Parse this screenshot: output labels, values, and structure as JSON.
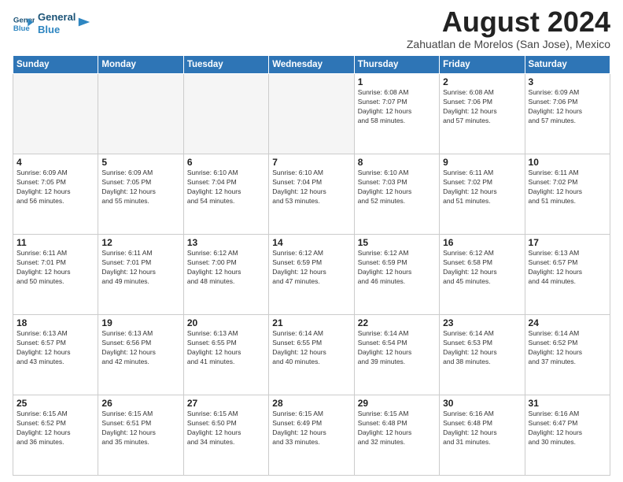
{
  "logo": {
    "line1": "General",
    "line2": "Blue"
  },
  "title": "August 2024",
  "location": "Zahuatlan de Morelos (San Jose), Mexico",
  "headers": [
    "Sunday",
    "Monday",
    "Tuesday",
    "Wednesday",
    "Thursday",
    "Friday",
    "Saturday"
  ],
  "weeks": [
    [
      {
        "day": "",
        "info": ""
      },
      {
        "day": "",
        "info": ""
      },
      {
        "day": "",
        "info": ""
      },
      {
        "day": "",
        "info": ""
      },
      {
        "day": "1",
        "info": "Sunrise: 6:08 AM\nSunset: 7:07 PM\nDaylight: 12 hours\nand 58 minutes."
      },
      {
        "day": "2",
        "info": "Sunrise: 6:08 AM\nSunset: 7:06 PM\nDaylight: 12 hours\nand 57 minutes."
      },
      {
        "day": "3",
        "info": "Sunrise: 6:09 AM\nSunset: 7:06 PM\nDaylight: 12 hours\nand 57 minutes."
      }
    ],
    [
      {
        "day": "4",
        "info": "Sunrise: 6:09 AM\nSunset: 7:05 PM\nDaylight: 12 hours\nand 56 minutes."
      },
      {
        "day": "5",
        "info": "Sunrise: 6:09 AM\nSunset: 7:05 PM\nDaylight: 12 hours\nand 55 minutes."
      },
      {
        "day": "6",
        "info": "Sunrise: 6:10 AM\nSunset: 7:04 PM\nDaylight: 12 hours\nand 54 minutes."
      },
      {
        "day": "7",
        "info": "Sunrise: 6:10 AM\nSunset: 7:04 PM\nDaylight: 12 hours\nand 53 minutes."
      },
      {
        "day": "8",
        "info": "Sunrise: 6:10 AM\nSunset: 7:03 PM\nDaylight: 12 hours\nand 52 minutes."
      },
      {
        "day": "9",
        "info": "Sunrise: 6:11 AM\nSunset: 7:02 PM\nDaylight: 12 hours\nand 51 minutes."
      },
      {
        "day": "10",
        "info": "Sunrise: 6:11 AM\nSunset: 7:02 PM\nDaylight: 12 hours\nand 51 minutes."
      }
    ],
    [
      {
        "day": "11",
        "info": "Sunrise: 6:11 AM\nSunset: 7:01 PM\nDaylight: 12 hours\nand 50 minutes."
      },
      {
        "day": "12",
        "info": "Sunrise: 6:11 AM\nSunset: 7:01 PM\nDaylight: 12 hours\nand 49 minutes."
      },
      {
        "day": "13",
        "info": "Sunrise: 6:12 AM\nSunset: 7:00 PM\nDaylight: 12 hours\nand 48 minutes."
      },
      {
        "day": "14",
        "info": "Sunrise: 6:12 AM\nSunset: 6:59 PM\nDaylight: 12 hours\nand 47 minutes."
      },
      {
        "day": "15",
        "info": "Sunrise: 6:12 AM\nSunset: 6:59 PM\nDaylight: 12 hours\nand 46 minutes."
      },
      {
        "day": "16",
        "info": "Sunrise: 6:12 AM\nSunset: 6:58 PM\nDaylight: 12 hours\nand 45 minutes."
      },
      {
        "day": "17",
        "info": "Sunrise: 6:13 AM\nSunset: 6:57 PM\nDaylight: 12 hours\nand 44 minutes."
      }
    ],
    [
      {
        "day": "18",
        "info": "Sunrise: 6:13 AM\nSunset: 6:57 PM\nDaylight: 12 hours\nand 43 minutes."
      },
      {
        "day": "19",
        "info": "Sunrise: 6:13 AM\nSunset: 6:56 PM\nDaylight: 12 hours\nand 42 minutes."
      },
      {
        "day": "20",
        "info": "Sunrise: 6:13 AM\nSunset: 6:55 PM\nDaylight: 12 hours\nand 41 minutes."
      },
      {
        "day": "21",
        "info": "Sunrise: 6:14 AM\nSunset: 6:55 PM\nDaylight: 12 hours\nand 40 minutes."
      },
      {
        "day": "22",
        "info": "Sunrise: 6:14 AM\nSunset: 6:54 PM\nDaylight: 12 hours\nand 39 minutes."
      },
      {
        "day": "23",
        "info": "Sunrise: 6:14 AM\nSunset: 6:53 PM\nDaylight: 12 hours\nand 38 minutes."
      },
      {
        "day": "24",
        "info": "Sunrise: 6:14 AM\nSunset: 6:52 PM\nDaylight: 12 hours\nand 37 minutes."
      }
    ],
    [
      {
        "day": "25",
        "info": "Sunrise: 6:15 AM\nSunset: 6:52 PM\nDaylight: 12 hours\nand 36 minutes."
      },
      {
        "day": "26",
        "info": "Sunrise: 6:15 AM\nSunset: 6:51 PM\nDaylight: 12 hours\nand 35 minutes."
      },
      {
        "day": "27",
        "info": "Sunrise: 6:15 AM\nSunset: 6:50 PM\nDaylight: 12 hours\nand 34 minutes."
      },
      {
        "day": "28",
        "info": "Sunrise: 6:15 AM\nSunset: 6:49 PM\nDaylight: 12 hours\nand 33 minutes."
      },
      {
        "day": "29",
        "info": "Sunrise: 6:15 AM\nSunset: 6:48 PM\nDaylight: 12 hours\nand 32 minutes."
      },
      {
        "day": "30",
        "info": "Sunrise: 6:16 AM\nSunset: 6:48 PM\nDaylight: 12 hours\nand 31 minutes."
      },
      {
        "day": "31",
        "info": "Sunrise: 6:16 AM\nSunset: 6:47 PM\nDaylight: 12 hours\nand 30 minutes."
      }
    ]
  ]
}
